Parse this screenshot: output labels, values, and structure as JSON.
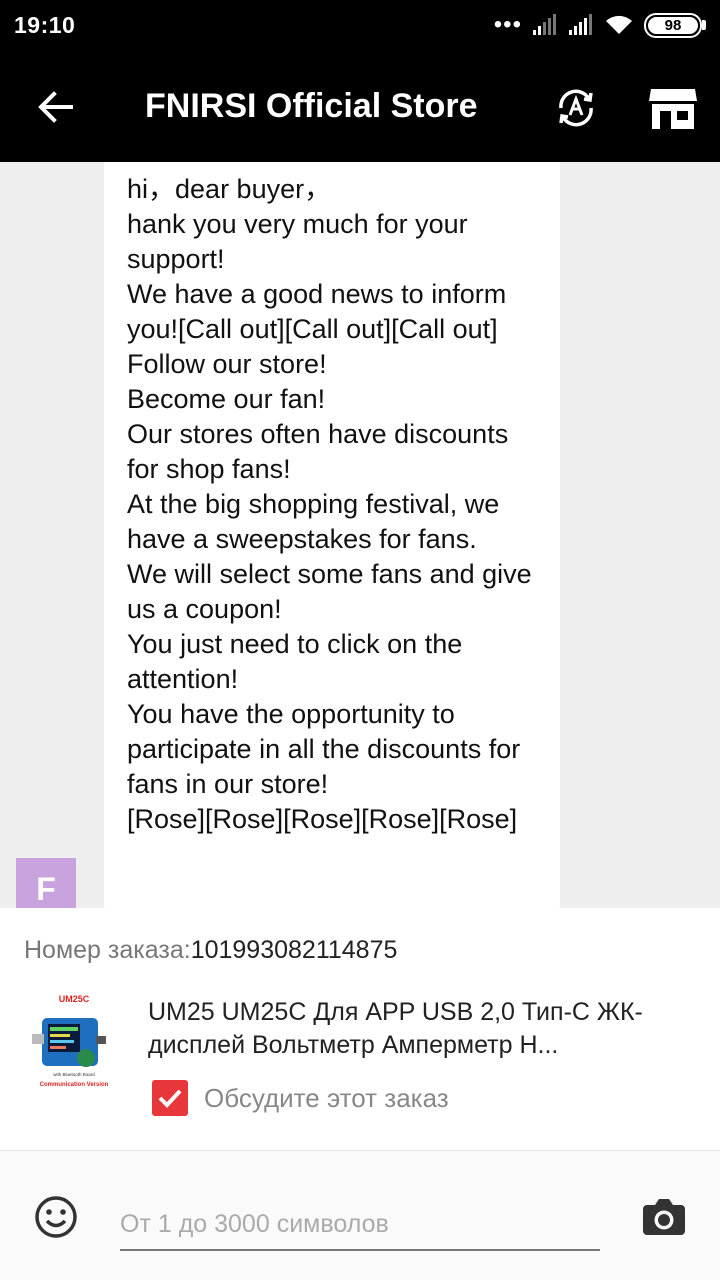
{
  "status_bar": {
    "time": "19:10",
    "battery": "98"
  },
  "header": {
    "title": "FNIRSI Official Store",
    "icons": [
      "back-arrow-icon",
      "translate-icon",
      "store-icon"
    ]
  },
  "chat": {
    "message": "hi，dear buyer，\nhank you very much for your support!\nWe have a good news to inform you![Call out][Call out][Call out]\nFollow our store!\nBecome our fan!\nOur stores often have discounts for shop fans!\nAt the big shopping festival, we have a sweepstakes for fans.\nWe will select some fans and give us a coupon!\nYou just need to click on the attention!\nYou have the opportunity to participate in all the discounts for fans in our store!\n[Rose][Rose][Rose][Rose][Rose]",
    "avatar_letter": "F",
    "avatar_color": "#c9a3dd"
  },
  "order": {
    "number_label": "Номер заказа:",
    "number_value": "101993082114875",
    "product_title": "UM25 UM25C Для APP USB 2,0 Тип-С ЖК-дисплей Вольтметр Амперметр Н...",
    "thumb_brand": "UM25C",
    "thumb_caption": "Communication Version",
    "thumb_sub": "with Bluetooth Board",
    "discuss_label": "Обсудите этот заказ",
    "discuss_checked": true,
    "checkbox_color": "#e8373a"
  },
  "input": {
    "placeholder": "От 1 до 3000 символов",
    "value": "",
    "icons": [
      "emoji-icon",
      "camera-icon"
    ]
  }
}
